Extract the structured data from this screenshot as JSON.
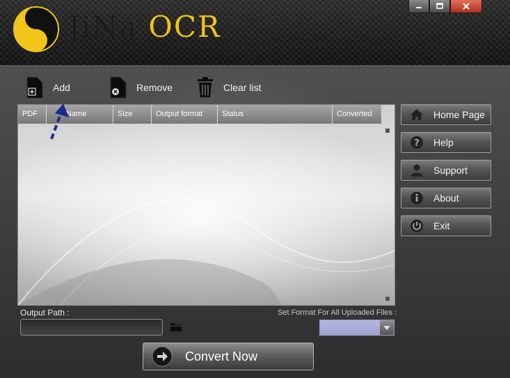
{
  "header": {
    "title_part1": "JiNa",
    "title_part2": "OCR",
    "window_buttons": [
      "minimize",
      "maximize",
      "close"
    ]
  },
  "toolbar": {
    "add_label": "Add",
    "remove_label": "Remove",
    "clear_label": "Clear list"
  },
  "file_table": {
    "columns": [
      "PDF",
      "Name",
      "Size",
      "Output format",
      "Status",
      "Converted"
    ],
    "rows": []
  },
  "nav": {
    "items": [
      {
        "label": "Home Page",
        "icon": "home-icon"
      },
      {
        "label": "Help",
        "icon": "question-icon"
      },
      {
        "label": "Support",
        "icon": "person-icon"
      },
      {
        "label": "About",
        "icon": "info-icon"
      },
      {
        "label": "Exit",
        "icon": "power-icon"
      }
    ]
  },
  "output": {
    "label": "Output Path :",
    "value": "",
    "format_label": "Set Format For All Uploaded Files :",
    "format_value": ""
  },
  "actions": {
    "convert_label": "Convert Now"
  },
  "colors": {
    "accent": "#f0c419",
    "format_select": "#a9addb"
  }
}
